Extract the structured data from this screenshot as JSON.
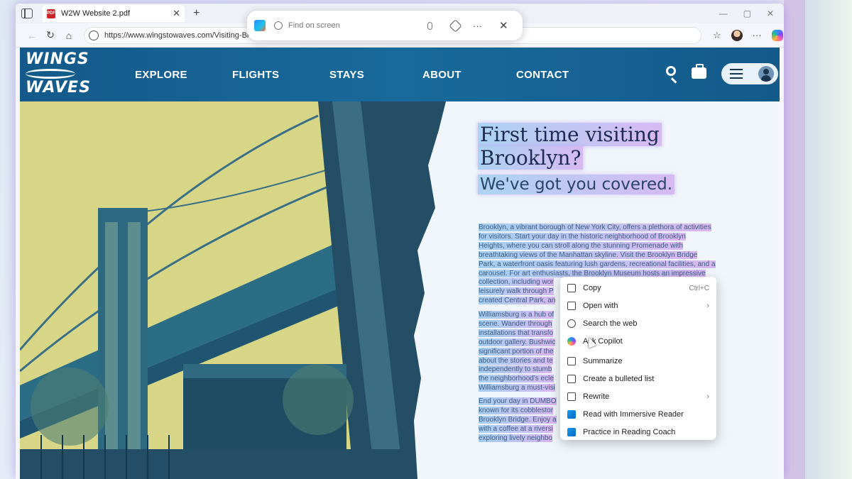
{
  "browser": {
    "tab_title": "W2W Website 2.pdf",
    "tab_close": "✕",
    "new_tab": "+",
    "url": "https://www.wingstowaves.com/Visiting-Brooklyn",
    "window_controls": [
      "—",
      "▢",
      "✕"
    ]
  },
  "find_on_screen": {
    "placeholder": "Find on screen",
    "more": "···",
    "close": "✕"
  },
  "site": {
    "logo_top": "WINGS",
    "logo_bottom": "WAVES",
    "nav": [
      "EXPLORE",
      "FLIGHTS",
      "STAYS",
      "ABOUT",
      "CONTACT"
    ]
  },
  "content": {
    "title_line1": "First time visiting",
    "title_line2": "Brooklyn?",
    "subtitle": "We've got you covered.",
    "paragraph1_lines": [
      "Brooklyn, a vibrant borough of New York City, offers a plethora of activities",
      "for visitors. Start your day in the historic neighborhood of Brooklyn",
      "Heights, where you can stroll along the stunning Promenade with",
      "breathtaking views of the Manhattan skyline. Visit the Brooklyn Bridge",
      "Park, a waterfront oasis featuring lush gardens, recreational facilities, and a",
      "carousel. For art enthusiasts, the Brooklyn Museum hosts an impressive",
      "collection, including wor",
      "leisurely walk through P",
      "created Central Park, an"
    ],
    "paragraph2_lines": [
      "Williamsburg is a hub of",
      "scene. Wander through",
      "installations that transfo",
      "outdoor gallery. Bushwic",
      "significant portion of the",
      "about the stories and te",
      "independently to stumb",
      "the neighborhood's ecle",
      "Williamsburg a must-visi"
    ],
    "paragraph3_lines": [
      "End your day in DUMBO",
      "known for its cobblestor",
      "Brooklyn Bridge. Enjoy a",
      "with a coffee at a riversi",
      "exploring lively neighbo"
    ]
  },
  "context_menu": {
    "items": [
      {
        "label": "Copy",
        "shortcut": "Ctrl+C",
        "icon": "copy-icon"
      },
      {
        "label": "Open with",
        "submenu": "›",
        "icon": "open-with-icon"
      },
      {
        "label": "Search the web",
        "icon": "globe-icon"
      },
      {
        "label": "Ask Copilot",
        "icon": "copilot-icon"
      },
      {
        "label": "Summarize",
        "icon": "summarize-icon"
      },
      {
        "label": "Create a bulleted list",
        "icon": "bulleted-list-icon"
      },
      {
        "label": "Rewrite",
        "submenu": "›",
        "icon": "rewrite-icon"
      },
      {
        "label": "Read with Immersive Reader",
        "icon": "immersive-reader-icon"
      },
      {
        "label": "Practice in Reading Coach",
        "icon": "reading-coach-icon"
      }
    ]
  },
  "colors": {
    "header_blue": "#186a9c",
    "highlight_start": "#a0cdf0",
    "highlight_end": "#d2aff0",
    "hero_yellow": "#d9d98b",
    "text_dark": "#1d2b4f"
  }
}
